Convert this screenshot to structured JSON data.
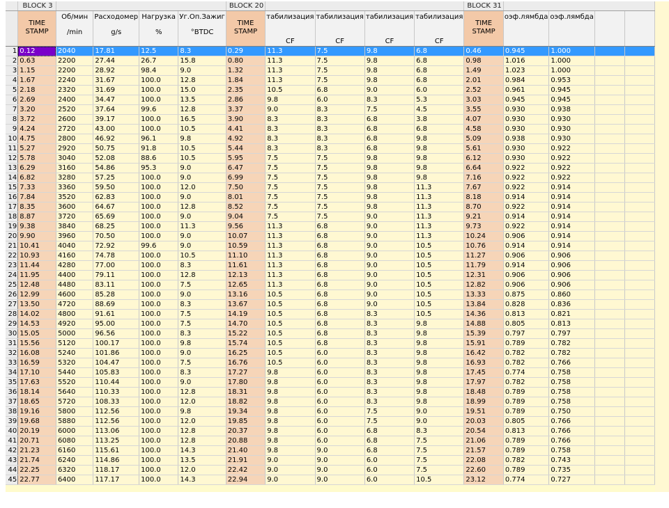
{
  "blocks": [
    {
      "label": "BLOCK 3",
      "span": 1
    },
    {
      "label": "",
      "span": 4
    },
    {
      "label": "BLOCK 20",
      "span": 1
    },
    {
      "label": "",
      "span": 4
    },
    {
      "label": "BLOCK 31",
      "span": 1
    },
    {
      "label": "",
      "span": 4
    }
  ],
  "headers": [
    {
      "top": "TIME",
      "bottom": "STAMP",
      "cf": "",
      "ts": true
    },
    {
      "top": "Об/мин",
      "bottom": "/min",
      "cf": "",
      "ts": false
    },
    {
      "top": "Расходомер",
      "bottom": "g/s",
      "cf": "",
      "ts": false
    },
    {
      "top": "Нагрузка",
      "bottom": "%",
      "cf": "",
      "ts": false
    },
    {
      "top": "Уг.Оп.Зажиг",
      "bottom": "°BTDC",
      "cf": "",
      "ts": false
    },
    {
      "top": "TIME",
      "bottom": "STAMP",
      "cf": "",
      "ts": true
    },
    {
      "top": "табилизация",
      "bottom": "",
      "cf": "CF",
      "ts": false
    },
    {
      "top": "табилизация",
      "bottom": "",
      "cf": "CF",
      "ts": false
    },
    {
      "top": "табилизация",
      "bottom": "",
      "cf": "CF",
      "ts": false
    },
    {
      "top": "табилизация",
      "bottom": "",
      "cf": "CF",
      "ts": false
    },
    {
      "top": "TIME",
      "bottom": "STAMP",
      "cf": "",
      "ts": true
    },
    {
      "top": "оэф.лямбда",
      "bottom": "",
      "cf": "",
      "ts": false
    },
    {
      "top": "оэф.лямбда",
      "bottom": "",
      "cf": "",
      "ts": false
    },
    {
      "top": "",
      "bottom": "",
      "cf": "",
      "ts": false
    },
    {
      "top": "",
      "bottom": "",
      "cf": "",
      "ts": false
    }
  ],
  "selected_row": 1,
  "rows": [
    [
      "1",
      "0.12",
      "2040",
      "17.81",
      "12.5",
      "8.3",
      "0.29",
      "11.3",
      "7.5",
      "9.8",
      "6.8",
      "0.46",
      "0.945",
      "1.000"
    ],
    [
      "2",
      "0.63",
      "2200",
      "27.44",
      "26.7",
      "15.8",
      "0.80",
      "11.3",
      "7.5",
      "9.8",
      "6.8",
      "0.98",
      "1.016",
      "1.000"
    ],
    [
      "3",
      "1.15",
      "2200",
      "28.92",
      "98.4",
      "9.0",
      "1.32",
      "11.3",
      "7.5",
      "9.8",
      "6.8",
      "1.49",
      "1.023",
      "1.000"
    ],
    [
      "4",
      "1.67",
      "2240",
      "31.67",
      "100.0",
      "12.8",
      "1.84",
      "11.3",
      "7.5",
      "9.8",
      "6.8",
      "2.01",
      "0.984",
      "0.953"
    ],
    [
      "5",
      "2.18",
      "2320",
      "31.69",
      "100.0",
      "15.0",
      "2.35",
      "10.5",
      "6.8",
      "9.0",
      "6.0",
      "2.52",
      "0.961",
      "0.945"
    ],
    [
      "6",
      "2.69",
      "2400",
      "34.47",
      "100.0",
      "13.5",
      "2.86",
      "9.8",
      "6.0",
      "8.3",
      "5.3",
      "3.03",
      "0.945",
      "0.945"
    ],
    [
      "7",
      "3.20",
      "2520",
      "37.64",
      "99.6",
      "12.8",
      "3.37",
      "9.0",
      "8.3",
      "7.5",
      "4.5",
      "3.55",
      "0.930",
      "0.938"
    ],
    [
      "8",
      "3.72",
      "2600",
      "39.17",
      "100.0",
      "16.5",
      "3.90",
      "8.3",
      "8.3",
      "6.8",
      "3.8",
      "4.07",
      "0.930",
      "0.930"
    ],
    [
      "9",
      "4.24",
      "2720",
      "43.00",
      "100.0",
      "10.5",
      "4.41",
      "8.3",
      "8.3",
      "6.8",
      "6.8",
      "4.58",
      "0.930",
      "0.930"
    ],
    [
      "10",
      "4.75",
      "2800",
      "46.92",
      "96.1",
      "9.8",
      "4.92",
      "8.3",
      "8.3",
      "6.8",
      "9.8",
      "5.09",
      "0.938",
      "0.930"
    ],
    [
      "11",
      "5.27",
      "2920",
      "50.75",
      "91.8",
      "10.5",
      "5.44",
      "8.3",
      "8.3",
      "6.8",
      "9.8",
      "5.61",
      "0.930",
      "0.922"
    ],
    [
      "12",
      "5.78",
      "3040",
      "52.08",
      "88.6",
      "10.5",
      "5.95",
      "7.5",
      "7.5",
      "9.8",
      "9.8",
      "6.12",
      "0.930",
      "0.922"
    ],
    [
      "13",
      "6.29",
      "3160",
      "54.86",
      "95.3",
      "9.0",
      "6.47",
      "7.5",
      "7.5",
      "9.8",
      "9.8",
      "6.64",
      "0.922",
      "0.922"
    ],
    [
      "14",
      "6.82",
      "3280",
      "57.25",
      "100.0",
      "9.0",
      "6.99",
      "7.5",
      "7.5",
      "9.8",
      "9.8",
      "7.16",
      "0.922",
      "0.922"
    ],
    [
      "15",
      "7.33",
      "3360",
      "59.50",
      "100.0",
      "12.0",
      "7.50",
      "7.5",
      "7.5",
      "9.8",
      "11.3",
      "7.67",
      "0.922",
      "0.914"
    ],
    [
      "16",
      "7.84",
      "3520",
      "62.83",
      "100.0",
      "9.0",
      "8.01",
      "7.5",
      "7.5",
      "9.8",
      "11.3",
      "8.18",
      "0.914",
      "0.914"
    ],
    [
      "17",
      "8.35",
      "3600",
      "64.67",
      "100.0",
      "12.8",
      "8.52",
      "7.5",
      "7.5",
      "9.8",
      "11.3",
      "8.70",
      "0.922",
      "0.914"
    ],
    [
      "18",
      "8.87",
      "3720",
      "65.69",
      "100.0",
      "9.0",
      "9.04",
      "7.5",
      "7.5",
      "9.0",
      "11.3",
      "9.21",
      "0.914",
      "0.914"
    ],
    [
      "19",
      "9.38",
      "3840",
      "68.25",
      "100.0",
      "11.3",
      "9.56",
      "11.3",
      "6.8",
      "9.0",
      "11.3",
      "9.73",
      "0.922",
      "0.914"
    ],
    [
      "20",
      "9.90",
      "3960",
      "70.50",
      "100.0",
      "9.0",
      "10.07",
      "11.3",
      "6.8",
      "9.0",
      "11.3",
      "10.24",
      "0.906",
      "0.914"
    ],
    [
      "21",
      "10.41",
      "4040",
      "72.92",
      "99.6",
      "9.0",
      "10.59",
      "11.3",
      "6.8",
      "9.0",
      "10.5",
      "10.76",
      "0.914",
      "0.914"
    ],
    [
      "22",
      "10.93",
      "4160",
      "74.78",
      "100.0",
      "10.5",
      "11.10",
      "11.3",
      "6.8",
      "9.0",
      "10.5",
      "11.27",
      "0.906",
      "0.906"
    ],
    [
      "23",
      "11.44",
      "4280",
      "77.00",
      "100.0",
      "8.3",
      "11.61",
      "11.3",
      "6.8",
      "9.0",
      "10.5",
      "11.79",
      "0.914",
      "0.906"
    ],
    [
      "24",
      "11.95",
      "4400",
      "79.11",
      "100.0",
      "12.8",
      "12.13",
      "11.3",
      "6.8",
      "9.0",
      "10.5",
      "12.31",
      "0.906",
      "0.906"
    ],
    [
      "25",
      "12.48",
      "4480",
      "83.11",
      "100.0",
      "7.5",
      "12.65",
      "11.3",
      "6.8",
      "9.0",
      "10.5",
      "12.82",
      "0.906",
      "0.906"
    ],
    [
      "26",
      "12.99",
      "4600",
      "85.28",
      "100.0",
      "9.0",
      "13.16",
      "10.5",
      "6.8",
      "9.0",
      "10.5",
      "13.33",
      "0.875",
      "0.860"
    ],
    [
      "27",
      "13.50",
      "4720",
      "88.69",
      "100.0",
      "8.3",
      "13.67",
      "10.5",
      "6.8",
      "9.0",
      "10.5",
      "13.84",
      "0.828",
      "0.836"
    ],
    [
      "28",
      "14.02",
      "4800",
      "91.61",
      "100.0",
      "7.5",
      "14.19",
      "10.5",
      "6.8",
      "8.3",
      "10.5",
      "14.36",
      "0.813",
      "0.821"
    ],
    [
      "29",
      "14.53",
      "4920",
      "95.00",
      "100.0",
      "7.5",
      "14.70",
      "10.5",
      "6.8",
      "8.3",
      "9.8",
      "14.88",
      "0.805",
      "0.813"
    ],
    [
      "30",
      "15.05",
      "5000",
      "96.56",
      "100.0",
      "8.3",
      "15.22",
      "10.5",
      "6.8",
      "8.3",
      "9.8",
      "15.39",
      "0.797",
      "0.797"
    ],
    [
      "31",
      "15.56",
      "5120",
      "100.17",
      "100.0",
      "9.8",
      "15.74",
      "10.5",
      "6.8",
      "8.3",
      "9.8",
      "15.91",
      "0.789",
      "0.782"
    ],
    [
      "32",
      "16.08",
      "5240",
      "101.86",
      "100.0",
      "9.0",
      "16.25",
      "10.5",
      "6.0",
      "8.3",
      "9.8",
      "16.42",
      "0.782",
      "0.782"
    ],
    [
      "33",
      "16.59",
      "5320",
      "104.47",
      "100.0",
      "7.5",
      "16.76",
      "10.5",
      "6.0",
      "8.3",
      "9.8",
      "16.93",
      "0.782",
      "0.766"
    ],
    [
      "34",
      "17.10",
      "5440",
      "105.83",
      "100.0",
      "8.3",
      "17.27",
      "9.8",
      "6.0",
      "8.3",
      "9.8",
      "17.45",
      "0.774",
      "0.758"
    ],
    [
      "35",
      "17.63",
      "5520",
      "110.44",
      "100.0",
      "9.0",
      "17.80",
      "9.8",
      "6.0",
      "8.3",
      "9.8",
      "17.97",
      "0.782",
      "0.758"
    ],
    [
      "36",
      "18.14",
      "5640",
      "110.33",
      "100.0",
      "12.8",
      "18.31",
      "9.8",
      "6.0",
      "8.3",
      "9.8",
      "18.48",
      "0.789",
      "0.758"
    ],
    [
      "37",
      "18.65",
      "5720",
      "108.33",
      "100.0",
      "12.0",
      "18.82",
      "9.8",
      "6.0",
      "8.3",
      "9.8",
      "18.99",
      "0.789",
      "0.758"
    ],
    [
      "38",
      "19.16",
      "5800",
      "112.56",
      "100.0",
      "9.8",
      "19.34",
      "9.8",
      "6.0",
      "7.5",
      "9.0",
      "19.51",
      "0.789",
      "0.750"
    ],
    [
      "39",
      "19.68",
      "5880",
      "112.56",
      "100.0",
      "12.0",
      "19.85",
      "9.8",
      "6.0",
      "7.5",
      "9.0",
      "20.03",
      "0.805",
      "0.766"
    ],
    [
      "40",
      "20.19",
      "6000",
      "113.06",
      "100.0",
      "12.8",
      "20.37",
      "9.8",
      "6.0",
      "6.8",
      "8.3",
      "20.54",
      "0.813",
      "0.766"
    ],
    [
      "41",
      "20.71",
      "6080",
      "113.25",
      "100.0",
      "12.8",
      "20.88",
      "9.8",
      "6.0",
      "6.8",
      "7.5",
      "21.06",
      "0.789",
      "0.766"
    ],
    [
      "42",
      "21.23",
      "6160",
      "115.61",
      "100.0",
      "14.3",
      "21.40",
      "9.8",
      "9.0",
      "6.8",
      "7.5",
      "21.57",
      "0.789",
      "0.758"
    ],
    [
      "43",
      "21.74",
      "6240",
      "114.86",
      "100.0",
      "13.5",
      "21.91",
      "9.0",
      "9.0",
      "6.0",
      "7.5",
      "22.08",
      "0.782",
      "0.743"
    ],
    [
      "44",
      "22.25",
      "6320",
      "118.17",
      "100.0",
      "12.0",
      "22.42",
      "9.0",
      "9.0",
      "6.0",
      "7.5",
      "22.60",
      "0.789",
      "0.735"
    ],
    [
      "45",
      "22.77",
      "6400",
      "117.17",
      "100.0",
      "14.3",
      "22.94",
      "9.0",
      "9.0",
      "6.0",
      "10.5",
      "23.12",
      "0.774",
      "0.727"
    ]
  ]
}
